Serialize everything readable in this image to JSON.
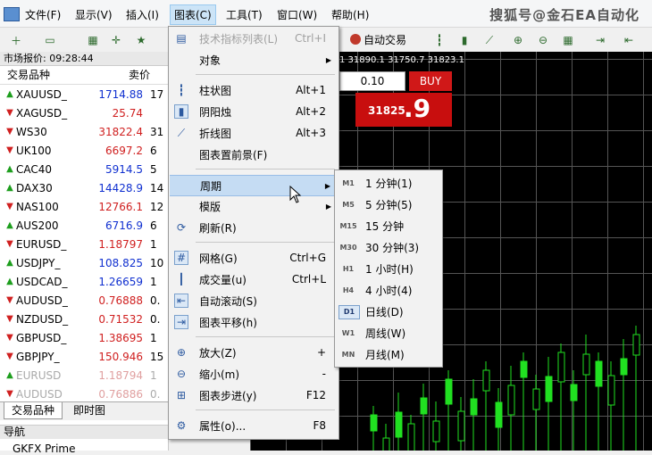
{
  "menubar": {
    "items": [
      "文件(F)",
      "显示(V)",
      "插入(I)",
      "图表(C)",
      "工具(T)",
      "窗口(W)",
      "帮助(H)"
    ],
    "watermark": "搜狐号@金石EA自动化"
  },
  "toolbar": {
    "autotrade_label": "自动交易"
  },
  "market_watch": {
    "title": "市场报价: 09:28:44",
    "col_symbol": "交易品种",
    "col_bid": "卖价",
    "rows": [
      {
        "symbol": "XAUUSD_",
        "bid": "1714.88",
        "extra": "17",
        "dir": "up",
        "color": "blue"
      },
      {
        "symbol": "XAGUSD_",
        "bid": "25.74",
        "extra": "",
        "dir": "down",
        "color": "red"
      },
      {
        "symbol": "WS30",
        "bid": "31822.4",
        "extra": "31",
        "dir": "down",
        "color": "red"
      },
      {
        "symbol": "UK100",
        "bid": "6697.2",
        "extra": "6",
        "dir": "down",
        "color": "red"
      },
      {
        "symbol": "CAC40",
        "bid": "5914.5",
        "extra": "5",
        "dir": "up",
        "color": "blue"
      },
      {
        "symbol": "DAX30",
        "bid": "14428.9",
        "extra": "14",
        "dir": "up",
        "color": "blue"
      },
      {
        "symbol": "NAS100",
        "bid": "12766.1",
        "extra": "12",
        "dir": "down",
        "color": "red"
      },
      {
        "symbol": "AUS200",
        "bid": "6716.9",
        "extra": "6",
        "dir": "up",
        "color": "blue"
      },
      {
        "symbol": "EURUSD_",
        "bid": "1.18797",
        "extra": "1",
        "dir": "down",
        "color": "red"
      },
      {
        "symbol": "USDJPY_",
        "bid": "108.825",
        "extra": "10",
        "dir": "up",
        "color": "blue"
      },
      {
        "symbol": "USDCAD_",
        "bid": "1.26659",
        "extra": "1",
        "dir": "up",
        "color": "blue"
      },
      {
        "symbol": "AUDUSD_",
        "bid": "0.76888",
        "extra": "0.",
        "dir": "down",
        "color": "red"
      },
      {
        "symbol": "NZDUSD_",
        "bid": "0.71532",
        "extra": "0.",
        "dir": "down",
        "color": "red"
      },
      {
        "symbol": "GBPUSD_",
        "bid": "1.38695",
        "extra": "1",
        "dir": "down",
        "color": "red"
      },
      {
        "symbol": "GBPJPY_",
        "bid": "150.946",
        "extra": "15",
        "dir": "down",
        "color": "red"
      },
      {
        "symbol": "EURUSD",
        "bid": "1.18794",
        "extra": "1",
        "dir": "up",
        "color": "red",
        "dim": true
      },
      {
        "symbol": "AUDUSD",
        "bid": "0.76886",
        "extra": "0.",
        "dir": "down",
        "color": "red",
        "dim": true
      }
    ],
    "tab_symbols": "交易品种",
    "tab_ticks": "即时图"
  },
  "navigator": {
    "title": "导航",
    "item": "GKFX Prime"
  },
  "chart": {
    "info": "1 31890.1 31750.7 31823.1",
    "lot": "0.10",
    "buy_label": "BUY",
    "buy_price_small": "31825",
    "buy_price_big": ".9"
  },
  "chart_menu": {
    "items": [
      {
        "label": "技术指标列表(L)",
        "shortcut": "Ctrl+I",
        "disabled": true,
        "icon": "indicator-list-icon"
      },
      {
        "label": "对象",
        "submenu": true
      },
      {
        "label": "柱状图",
        "shortcut": "Alt+1",
        "icon": "bar-chart-icon"
      },
      {
        "label": "阴阳烛",
        "shortcut": "Alt+2",
        "icon": "candlestick-icon",
        "boxed": true
      },
      {
        "label": "折线图",
        "shortcut": "Alt+3",
        "icon": "line-chart-icon"
      },
      {
        "label": "图表置前景(F)"
      },
      {
        "label": "周期",
        "submenu": true,
        "hover": true
      },
      {
        "label": "模版",
        "submenu": true
      },
      {
        "label": "刷新(R)",
        "icon": "refresh-icon"
      },
      {
        "label": "网格(G)",
        "shortcut": "Ctrl+G",
        "icon": "grid-icon",
        "boxed": true
      },
      {
        "label": "成交量(u)",
        "shortcut": "Ctrl+L",
        "icon": "volume-icon"
      },
      {
        "label": "自动滚动(S)",
        "icon": "autoscroll-icon",
        "boxed": true
      },
      {
        "label": "图表平移(h)",
        "icon": "chart-shift-icon",
        "boxed": true
      },
      {
        "label": "放大(Z)",
        "shortcut": "+",
        "icon": "zoom-in-icon"
      },
      {
        "label": "缩小(m)",
        "shortcut": "-",
        "icon": "zoom-out-icon"
      },
      {
        "label": "图表步进(y)",
        "shortcut": "F12",
        "icon": "step-icon"
      },
      {
        "label": "属性(o)...",
        "shortcut": "F8",
        "icon": "properties-icon"
      }
    ]
  },
  "period_menu": {
    "items": [
      {
        "code": "M1",
        "label": "1 分钟(1)"
      },
      {
        "code": "M5",
        "label": "5 分钟(5)"
      },
      {
        "code": "M15",
        "label": "15 分钟"
      },
      {
        "code": "M30",
        "label": "30 分钟(3)"
      },
      {
        "code": "H1",
        "label": "1 小时(H)"
      },
      {
        "code": "H4",
        "label": "4 小时(4)"
      },
      {
        "code": "D1",
        "label": "日线(D)",
        "checked": true
      },
      {
        "code": "W1",
        "label": "周线(W)"
      },
      {
        "code": "MN",
        "label": "月线(M)"
      }
    ]
  }
}
